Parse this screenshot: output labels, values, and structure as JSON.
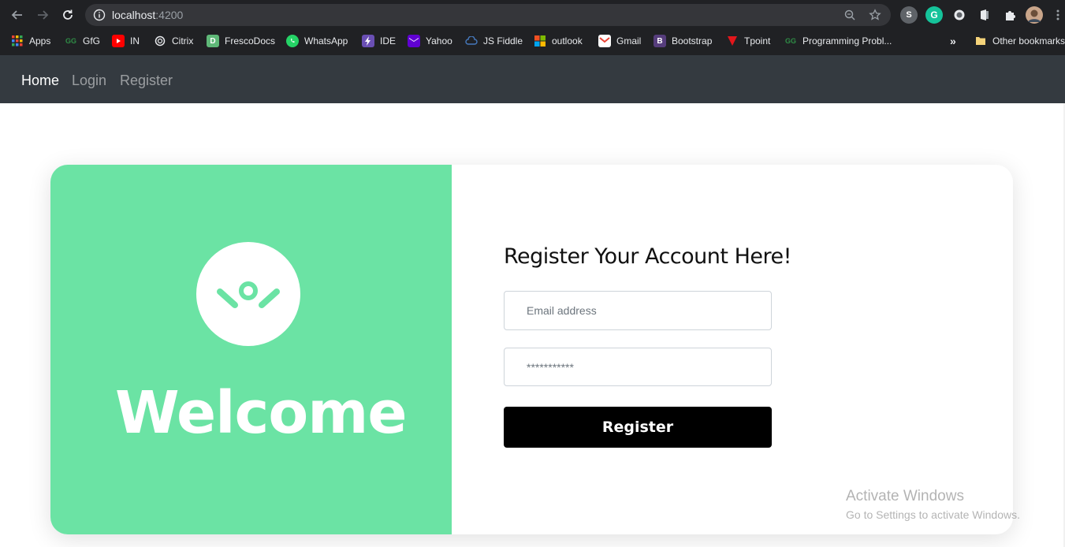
{
  "browser": {
    "url_host": "localhost",
    "url_port": ":4200",
    "bookmarks": [
      {
        "label": "Apps",
        "icon": "apps-grid-icon"
      },
      {
        "label": "GfG",
        "icon": "gfg-icon"
      },
      {
        "label": "IN",
        "icon": "youtube-icon"
      },
      {
        "label": "Citrix",
        "icon": "citrix-icon"
      },
      {
        "label": "FrescoDocs",
        "icon": "frescodocs-icon"
      },
      {
        "label": "WhatsApp",
        "icon": "whatsapp-icon"
      },
      {
        "label": "IDE",
        "icon": "ide-icon"
      },
      {
        "label": "Yahoo",
        "icon": "yahoo-icon"
      },
      {
        "label": "JS Fiddle",
        "icon": "jsfiddle-icon"
      },
      {
        "label": "outlook",
        "icon": "microsoft-icon"
      },
      {
        "label": "Gmail",
        "icon": "gmail-icon"
      },
      {
        "label": "Bootstrap",
        "icon": "bootstrap-icon"
      },
      {
        "label": "Tpoint",
        "icon": "tpoint-icon"
      },
      {
        "label": "Programming Probl...",
        "icon": "gfg-icon"
      }
    ],
    "overflow_label": "»",
    "other_bookmarks": "Other bookmarks"
  },
  "navbar": {
    "items": [
      {
        "label": "Home",
        "active": true
      },
      {
        "label": "Login",
        "active": false
      },
      {
        "label": "Register",
        "active": false
      }
    ]
  },
  "welcome_panel": {
    "heading": "Welcome",
    "background_color": "#6be3a4"
  },
  "form": {
    "title": "Register Your Account Here!",
    "email_placeholder": "Email address",
    "password_placeholder": "***********",
    "submit_label": "Register"
  },
  "watermark": {
    "line1": "Activate Windows",
    "line2": "Go to Settings to activate Windows."
  }
}
